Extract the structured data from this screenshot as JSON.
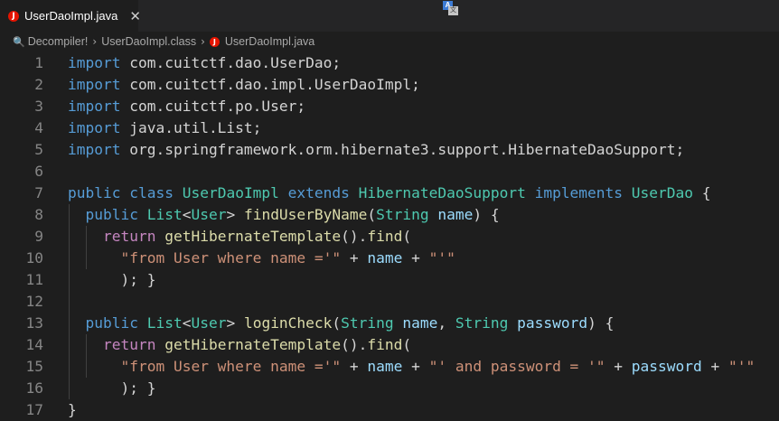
{
  "tab": {
    "label": "UserDaoImpl.java",
    "icon": "java-file-icon",
    "close": "✕"
  },
  "breadcrumb": [
    "Decompiler!",
    "UserDaoImpl.class",
    "UserDaoImpl.java"
  ],
  "colors": {
    "keyword": "#569cd6",
    "type": "#4ec9b0",
    "function": "#dcdcaa",
    "variable": "#9cdcfe",
    "control": "#c586c0",
    "string": "#ce9178",
    "plain": "#d4d4d4",
    "line_number": "#858585",
    "java_icon": "#e51400"
  },
  "lines": [
    {
      "n": "1",
      "tokens": [
        [
          "k",
          "import"
        ],
        [
          "p",
          " com.cuitctf.dao.UserDao;"
        ]
      ]
    },
    {
      "n": "2",
      "tokens": [
        [
          "k",
          "import"
        ],
        [
          "p",
          " com.cuitctf.dao.impl.UserDaoImpl;"
        ]
      ]
    },
    {
      "n": "3",
      "tokens": [
        [
          "k",
          "import"
        ],
        [
          "p",
          " com.cuitctf.po.User;"
        ]
      ]
    },
    {
      "n": "4",
      "tokens": [
        [
          "k",
          "import"
        ],
        [
          "p",
          " java.util.List;"
        ]
      ]
    },
    {
      "n": "5",
      "tokens": [
        [
          "k",
          "import"
        ],
        [
          "p",
          " org.springframework.orm.hibernate3.support.HibernateDaoSupport;"
        ]
      ]
    },
    {
      "n": "6",
      "tokens": []
    },
    {
      "n": "7",
      "tokens": [
        [
          "k",
          "public"
        ],
        [
          "p",
          " "
        ],
        [
          "k",
          "class"
        ],
        [
          "p",
          " "
        ],
        [
          "t",
          "UserDaoImpl"
        ],
        [
          "p",
          " "
        ],
        [
          "k",
          "extends"
        ],
        [
          "p",
          " "
        ],
        [
          "t",
          "HibernateDaoSupport"
        ],
        [
          "p",
          " "
        ],
        [
          "k",
          "implements"
        ],
        [
          "p",
          " "
        ],
        [
          "t",
          "UserDao"
        ],
        [
          "p",
          " {"
        ]
      ]
    },
    {
      "n": "8",
      "tokens": [
        [
          "p",
          "  "
        ],
        [
          "k",
          "public"
        ],
        [
          "p",
          " "
        ],
        [
          "t",
          "List"
        ],
        [
          "p",
          "<"
        ],
        [
          "t",
          "User"
        ],
        [
          "p",
          "> "
        ],
        [
          "f",
          "findUserByName"
        ],
        [
          "p",
          "("
        ],
        [
          "t",
          "String"
        ],
        [
          "p",
          " "
        ],
        [
          "v",
          "name"
        ],
        [
          "p",
          ") {"
        ]
      ]
    },
    {
      "n": "9",
      "tokens": [
        [
          "p",
          "    "
        ],
        [
          "c",
          "return"
        ],
        [
          "p",
          " "
        ],
        [
          "f",
          "getHibernateTemplate"
        ],
        [
          "p",
          "()."
        ],
        [
          "f",
          "find"
        ],
        [
          "p",
          "("
        ]
      ]
    },
    {
      "n": "10",
      "tokens": [
        [
          "p",
          "      "
        ],
        [
          "s",
          "\"from User where name ='\""
        ],
        [
          "p",
          " + "
        ],
        [
          "v",
          "name"
        ],
        [
          "p",
          " + "
        ],
        [
          "s",
          "\"'\""
        ]
      ]
    },
    {
      "n": "11",
      "tokens": [
        [
          "p",
          "      ); }"
        ]
      ]
    },
    {
      "n": "12",
      "tokens": []
    },
    {
      "n": "13",
      "tokens": [
        [
          "p",
          "  "
        ],
        [
          "k",
          "public"
        ],
        [
          "p",
          " "
        ],
        [
          "t",
          "List"
        ],
        [
          "p",
          "<"
        ],
        [
          "t",
          "User"
        ],
        [
          "p",
          "> "
        ],
        [
          "f",
          "loginCheck"
        ],
        [
          "p",
          "("
        ],
        [
          "t",
          "String"
        ],
        [
          "p",
          " "
        ],
        [
          "v",
          "name"
        ],
        [
          "p",
          ", "
        ],
        [
          "t",
          "String"
        ],
        [
          "p",
          " "
        ],
        [
          "v",
          "password"
        ],
        [
          "p",
          ") {"
        ]
      ]
    },
    {
      "n": "14",
      "tokens": [
        [
          "p",
          "    "
        ],
        [
          "c",
          "return"
        ],
        [
          "p",
          " "
        ],
        [
          "f",
          "getHibernateTemplate"
        ],
        [
          "p",
          "()."
        ],
        [
          "f",
          "find"
        ],
        [
          "p",
          "("
        ]
      ]
    },
    {
      "n": "15",
      "tokens": [
        [
          "p",
          "      "
        ],
        [
          "s",
          "\"from User where name ='\""
        ],
        [
          "p",
          " + "
        ],
        [
          "v",
          "name"
        ],
        [
          "p",
          " + "
        ],
        [
          "s",
          "\"' and password = '\""
        ],
        [
          "p",
          " + "
        ],
        [
          "v",
          "password"
        ],
        [
          "p",
          " + "
        ],
        [
          "s",
          "\"'\""
        ]
      ]
    },
    {
      "n": "16",
      "tokens": [
        [
          "p",
          "      ); }"
        ]
      ]
    },
    {
      "n": "17",
      "tokens": [
        [
          "p",
          "}"
        ]
      ]
    }
  ]
}
